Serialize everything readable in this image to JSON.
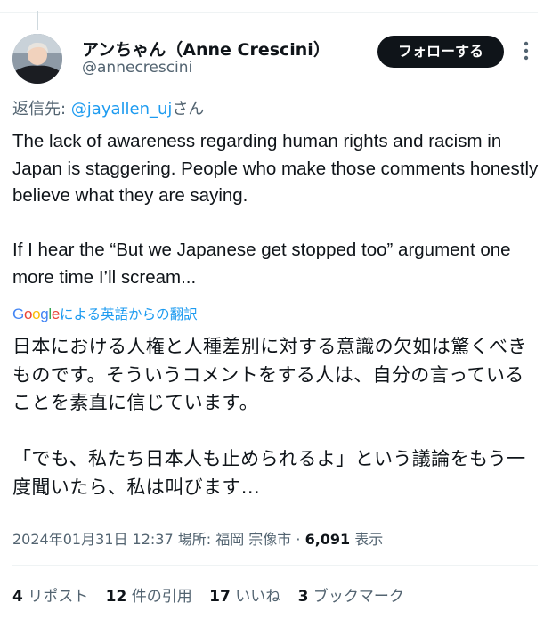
{
  "author": {
    "display_name": "アンちゃん（Anne Crescini）",
    "handle": "@annecrescini"
  },
  "follow_label": "フォローする",
  "reply_prefix": "返信先: ",
  "reply_handle": "@jayallen_uj",
  "reply_suffix": "さん",
  "tweet_text": "The lack of awareness regarding human rights and racism in Japan is staggering. People who make those comments honestly believe what they are saying.\n\nIf I hear the “But we Japanese get stopped too” argument one more time I’ll scream...",
  "translation": {
    "brand": "Google",
    "label": "による英語からの翻訳",
    "text": "日本における人権と人種差別に対する意識の欠如は驚くべきものです。そういうコメントをする人は、自分の言っていることを素直に信じています。\n\n「でも、私たち日本人も止められるよ」という議論をもう一度聞いたら、私は叫びます..."
  },
  "meta": {
    "datetime": "2024年01月31日 12:37",
    "location": " 場所: 福岡 宗像市 · ",
    "views_count": "6,091",
    "views_label": " 表示"
  },
  "stats": {
    "reposts_count": "4",
    "reposts_label": " リポスト",
    "quotes_count": "12",
    "quotes_label": " 件の引用",
    "likes_count": "17",
    "likes_label": " いいね",
    "bookmarks_count": "3",
    "bookmarks_label": " ブックマーク"
  },
  "colors": {
    "accent": "#1d9bf0",
    "secondary_text": "#536471",
    "primary_text": "#0f1419"
  }
}
